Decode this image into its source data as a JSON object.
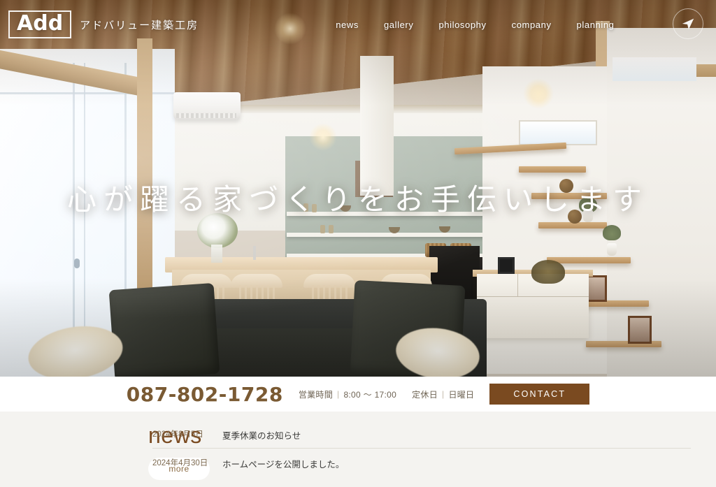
{
  "header": {
    "logo_mark": "Add",
    "logo_jp": "アドバリュー建築工房",
    "nav": [
      {
        "label": "news"
      },
      {
        "label": "gallery"
      },
      {
        "label": "philosophy"
      },
      {
        "label": "company"
      },
      {
        "label": "planning"
      }
    ],
    "send_icon": "paper-plane-icon"
  },
  "hero": {
    "headline": "心が躍る家づくりをお手伝いします"
  },
  "contact_bar": {
    "phone": "087-802-1728",
    "hours_label": "営業時間",
    "hours_value": "8:00 〜 17:00",
    "closed_label": "定休日",
    "closed_value": "日曜日",
    "separator": "|",
    "button_label": "CONTACT"
  },
  "news": {
    "heading": "news",
    "more_label": "more",
    "items": [
      {
        "date": "2024年8月5日",
        "title": "夏季休業のお知らせ"
      },
      {
        "date": "2024年4月30日",
        "title": "ホームページを公開しました。"
      }
    ]
  },
  "colors": {
    "brand_brown": "#7a4a20",
    "phone_brown": "#7a5a33",
    "news_bg": "#f4f3f0",
    "text_dark": "#3a3a38"
  }
}
